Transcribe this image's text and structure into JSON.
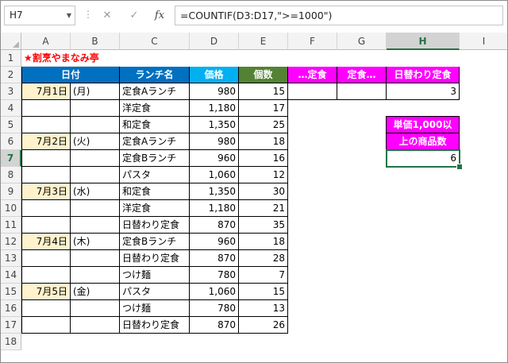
{
  "namebox": "H7",
  "formula": "=COUNTIF(D3:D17,\">=1000\")",
  "fx_label": "fx",
  "cancel_glyph": "✕",
  "enter_glyph": "✓",
  "columns": [
    "A",
    "B",
    "C",
    "D",
    "E",
    "F",
    "G",
    "H",
    "I"
  ],
  "rows": [
    "1",
    "2",
    "3",
    "4",
    "5",
    "6",
    "7",
    "8",
    "9",
    "10",
    "11",
    "12",
    "13",
    "14",
    "15",
    "16",
    "17",
    "18"
  ],
  "title": "★割烹やまなみ亭",
  "headers": {
    "date": "日付",
    "menu": "ランチ名",
    "price": "価格",
    "qty": "個数",
    "f": "…定食",
    "g": "定食…",
    "h": "日替わり定食"
  },
  "dates": [
    "7月1日",
    "7月2日",
    "7月3日",
    "7月4日",
    "7月5日"
  ],
  "weekdays": [
    "(月)",
    "(火)",
    "(水)",
    "(木)",
    "(金)"
  ],
  "table": [
    {
      "menu": "定食Aランチ",
      "price": "980",
      "qty": "15"
    },
    {
      "menu": "洋定食",
      "price": "1,180",
      "qty": "17"
    },
    {
      "menu": "和定食",
      "price": "1,350",
      "qty": "25"
    },
    {
      "menu": "定食Aランチ",
      "price": "980",
      "qty": "18"
    },
    {
      "menu": "定食Bランチ",
      "price": "960",
      "qty": "16"
    },
    {
      "menu": "パスタ",
      "price": "1,060",
      "qty": "12"
    },
    {
      "menu": "和定食",
      "price": "1,350",
      "qty": "30"
    },
    {
      "menu": "洋定食",
      "price": "1,180",
      "qty": "21"
    },
    {
      "menu": "日替わり定食",
      "price": "870",
      "qty": "35"
    },
    {
      "menu": "定食Bランチ",
      "price": "960",
      "qty": "18"
    },
    {
      "menu": "日替わり定食",
      "price": "870",
      "qty": "28"
    },
    {
      "menu": "つけ麺",
      "price": "780",
      "qty": "7"
    },
    {
      "menu": "パスタ",
      "price": "1,060",
      "qty": "15"
    },
    {
      "menu": "つけ麺",
      "price": "780",
      "qty": "13"
    },
    {
      "menu": "日替わり定食",
      "price": "870",
      "qty": "26"
    }
  ],
  "h3_value": "3",
  "label_line1": "単価1,000以",
  "label_line2": "上の商品数",
  "h7_value": "6",
  "colors": {
    "blue": "#0070c0",
    "cyan": "#00b0f0",
    "green": "#548235",
    "magenta": "#ff00ff",
    "date_fill": "#fff2cc",
    "select": "#217346",
    "title_red": "#ff0000"
  }
}
